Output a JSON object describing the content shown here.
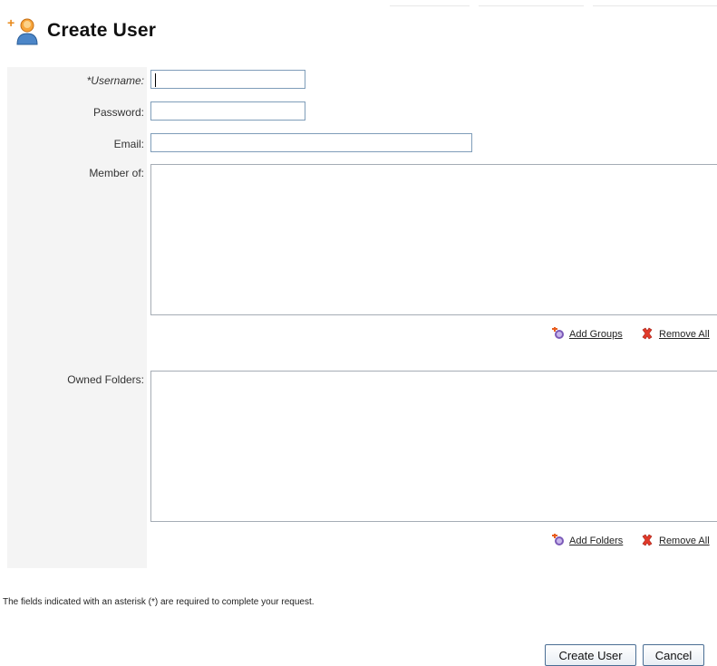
{
  "page": {
    "title": "Create User",
    "icon": "add-user-icon"
  },
  "form": {
    "username_label": "*Username:",
    "username_value": "",
    "password_label": "Password:",
    "password_value": "",
    "email_label": "Email:",
    "email_value": "",
    "member_of_label": "Member of:",
    "member_of_items": [],
    "owned_folders_label": "Owned Folders:",
    "owned_folders_items": []
  },
  "actions": {
    "add_groups_label": "Add Groups",
    "remove_all_groups_label": "Remove All",
    "add_folders_label": "Add Folders",
    "remove_all_folders_label": "Remove All",
    "add_icon": "add-colorful-icon",
    "remove_icon": "red-x-icon"
  },
  "footer": {
    "required_note": "The fields indicated with an asterisk (*) are required to complete your request.",
    "create_button": "Create User",
    "cancel_button": "Cancel"
  },
  "colors": {
    "input_border": "#7f9db9",
    "label_column_bg": "#f4f4f4",
    "button_border": "#4a6e94"
  }
}
